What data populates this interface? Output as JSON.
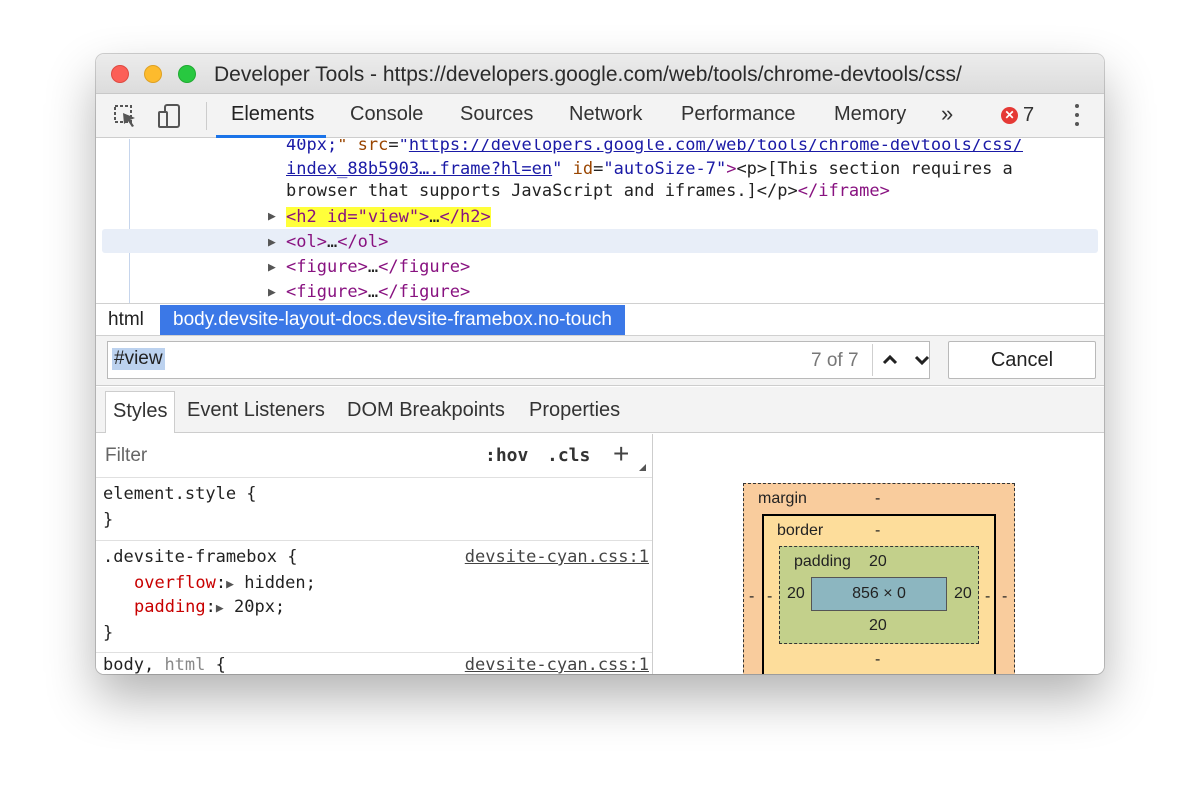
{
  "window": {
    "title": "Developer Tools - https://developers.google.com/web/tools/chrome-devtools/css/"
  },
  "toolbar": {
    "inspect_icon": "inspect-element-icon",
    "device_icon": "device-toolbar-icon",
    "tabs": [
      {
        "label": "Elements",
        "active": true
      },
      {
        "label": "Console"
      },
      {
        "label": "Sources"
      },
      {
        "label": "Network"
      },
      {
        "label": "Performance"
      },
      {
        "label": "Memory"
      }
    ],
    "overflow": "»",
    "error_count": "7"
  },
  "dom": {
    "line1": {
      "pre": "40px;",
      "attr1": "src",
      "val1": "https://developers.google.com/web/tools/chrome-devtools/css/"
    },
    "line2": {
      "link": "index_88b5903….frame?hl=en",
      "attr": "id",
      "val": "autoSize-7",
      "rest": "<p>[This section requires a"
    },
    "line3": {
      "text": "browser that supports JavaScript and iframes.]</p>",
      "close_tag": "</iframe>"
    },
    "nodes": [
      {
        "open": "<h2 id=\"view\">",
        "ellipsis": "…",
        "close": "</h2>",
        "highlighted": true
      },
      {
        "open": "<ol>",
        "ellipsis": "…",
        "close": "</ol>",
        "hovered": true
      },
      {
        "open": "<figure>",
        "ellipsis": "…",
        "close": "</figure>"
      },
      {
        "open": "<figure>",
        "ellipsis": "…",
        "close": "</figure>"
      }
    ]
  },
  "breadcrumbs": {
    "items": [
      "html",
      "body.devsite-layout-docs.devsite-framebox.no-touch"
    ]
  },
  "search": {
    "query": "#view",
    "match_count": "7 of 7",
    "cancel_label": "Cancel"
  },
  "panel_tabs": [
    "Styles",
    "Event Listeners",
    "DOM Breakpoints",
    "Properties"
  ],
  "styles": {
    "filter_placeholder": "Filter",
    "hov": ":hov",
    "cls": ".cls",
    "add": "+",
    "rules": [
      {
        "selector": "element.style {",
        "close": "}"
      },
      {
        "selector": ".devsite-framebox {",
        "source": "devsite-cyan.css:1",
        "props": [
          {
            "name": "overflow",
            "value": "hidden;"
          },
          {
            "name": "padding",
            "value": "20px;"
          }
        ],
        "close": "}"
      },
      {
        "selector_main": "body,",
        "selector_muted": "html",
        "brace": "{",
        "source": "devsite-cyan.css:1"
      }
    ]
  },
  "box_model": {
    "margin_label": "margin",
    "margin_top": "-",
    "margin_left": "-",
    "margin_right": "-",
    "border_label": "border",
    "border_top": "-",
    "border_left": "-",
    "border_right": "-",
    "border_bottom": "-",
    "padding_label": "padding",
    "padding_top": "20",
    "padding_left": "20",
    "padding_right": "20",
    "padding_bottom": "20",
    "content": "856 × 0"
  },
  "colors": {
    "accent": "#1a73e8",
    "breadcrumb_selected": "#3b78e7",
    "search_highlight": "#ffff3a",
    "margin": "#f9cc9d",
    "border": "#fddd9b",
    "padding": "#c3d08b",
    "content": "#8cb6c0"
  }
}
